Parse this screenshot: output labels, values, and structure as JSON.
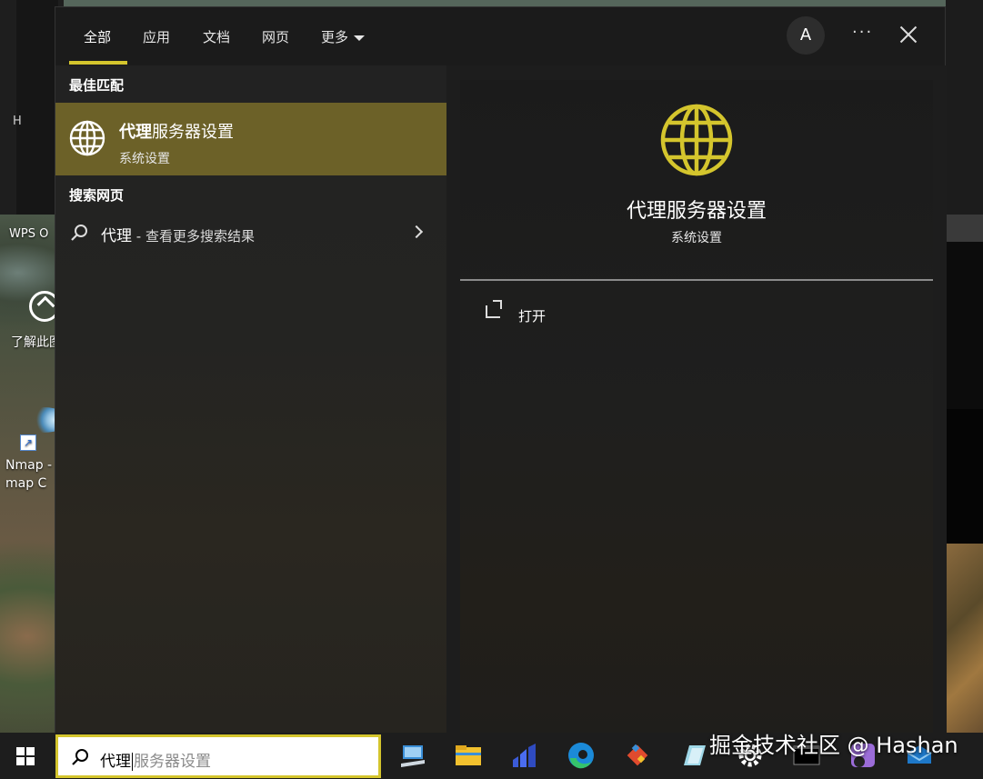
{
  "desktop": {
    "background_window_title": "H",
    "icons": [
      {
        "label": "WPS O"
      },
      {
        "label": "了解此图"
      },
      {
        "label": "Nmap - map C"
      }
    ]
  },
  "search_panel": {
    "tabs": [
      {
        "label": "全部",
        "active": true
      },
      {
        "label": "应用"
      },
      {
        "label": "文档"
      },
      {
        "label": "网页"
      },
      {
        "label": "更多"
      }
    ],
    "account_initial": "A",
    "more_options_glyph": "···",
    "best_match": {
      "section_label": "最佳匹配",
      "title_bold": "代理",
      "title_rest": "服务器设置",
      "subtitle": "系统设置",
      "icon": "globe-icon"
    },
    "web_search": {
      "section_label": "搜索网页",
      "query": "代理",
      "suffix": " - 查看更多搜索结果"
    },
    "detail": {
      "title": "代理服务器设置",
      "subtitle": "系统设置",
      "actions": [
        {
          "label": "打开",
          "icon": "open-external-icon"
        }
      ]
    },
    "accent_color": "#d4c52d",
    "highlight_color": "#6c6128"
  },
  "taskbar": {
    "search_typed": "代理",
    "search_suggestion": "服务器设置",
    "apps": [
      "remote-desktop",
      "file-explorer",
      "chart-app",
      "edge",
      "git",
      "notepad",
      "settings",
      "terminal",
      "app-purple",
      "app-blue"
    ]
  },
  "watermark": "掘金技术社区 @ Hashan"
}
